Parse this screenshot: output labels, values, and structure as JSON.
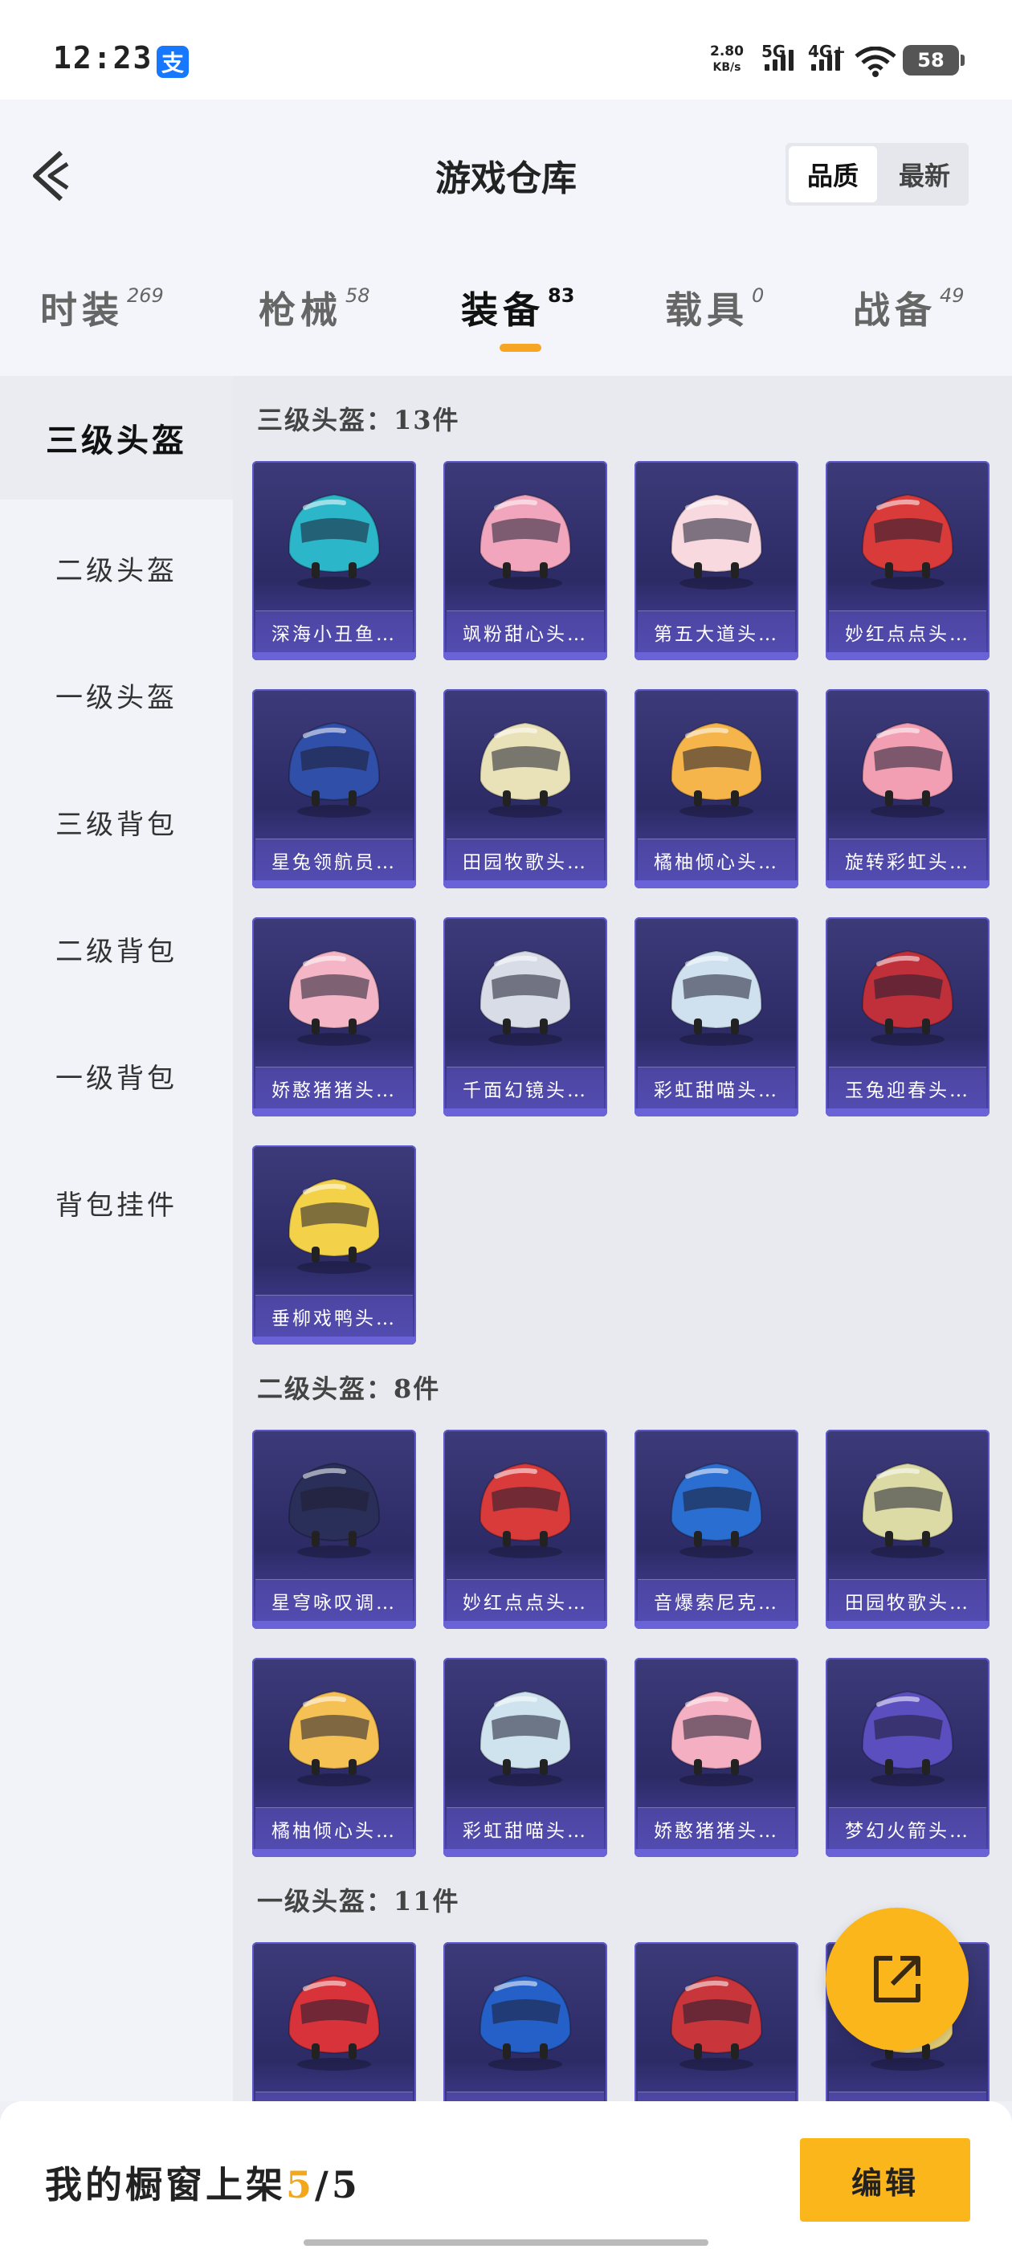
{
  "status_bar": {
    "time": "12:23",
    "alipay_glyph": "支",
    "speed_value": "2.80",
    "speed_unit": "KB/s",
    "net1": "5G",
    "net2": "4G+",
    "battery": "58"
  },
  "header": {
    "title": "游戏仓库",
    "sort_options": [
      "品质",
      "最新"
    ],
    "sort_active": "品质"
  },
  "tabs": [
    {
      "label": "时装",
      "count": "269"
    },
    {
      "label": "枪械",
      "count": "58"
    },
    {
      "label": "装备",
      "count": "83",
      "active": true
    },
    {
      "label": "载具",
      "count": "0"
    },
    {
      "label": "战备",
      "count": "49"
    }
  ],
  "sidebar": {
    "items": [
      "三级头盔",
      "二级头盔",
      "一级头盔",
      "三级背包",
      "二级背包",
      "一级背包",
      "背包挂件"
    ],
    "active": "三级头盔"
  },
  "sections": [
    {
      "title": "三级头盔：13件",
      "items": [
        {
          "name": "深海小丑鱼…",
          "icon": "helmet-icon",
          "color": "#2bb7c9"
        },
        {
          "name": "飒粉甜心头…",
          "icon": "helmet-icon",
          "color": "#f2a6bd"
        },
        {
          "name": "第五大道头…",
          "icon": "helmet-icon",
          "color": "#f7d9df"
        },
        {
          "name": "妙红点点头…",
          "icon": "helmet-icon",
          "color": "#d93a3a"
        },
        {
          "name": "星兔领航员…",
          "icon": "helmet-icon",
          "color": "#2f4fa8"
        },
        {
          "name": "田园牧歌头…",
          "icon": "helmet-icon",
          "color": "#e9e2b8"
        },
        {
          "name": "橘柚倾心头…",
          "icon": "helmet-icon",
          "color": "#f5b54a"
        },
        {
          "name": "旋转彩虹头…",
          "icon": "helmet-icon",
          "color": "#f29fb3"
        },
        {
          "name": "娇憨猪猪头…",
          "icon": "helmet-icon",
          "color": "#f4b6c6"
        },
        {
          "name": "千面幻镜头…",
          "icon": "helmet-icon",
          "color": "#d8dce6"
        },
        {
          "name": "彩虹甜喵头…",
          "icon": "helmet-icon",
          "color": "#cfe0ef"
        },
        {
          "name": "玉兔迎春头…",
          "icon": "helmet-icon",
          "color": "#c0303a"
        },
        {
          "name": "垂柳戏鸭头…",
          "icon": "helmet-icon",
          "color": "#f3d24a"
        }
      ]
    },
    {
      "title": "二级头盔：8件",
      "items": [
        {
          "name": "星穹咏叹调…",
          "icon": "helmet-icon",
          "color": "#2a2f5a"
        },
        {
          "name": "妙红点点头…",
          "icon": "helmet-icon",
          "color": "#d93a3a"
        },
        {
          "name": "音爆索尼克…",
          "icon": "helmet-icon",
          "color": "#2b6ed1"
        },
        {
          "name": "田园牧歌头…",
          "icon": "helmet-icon",
          "color": "#dcdba6"
        },
        {
          "name": "橘柚倾心头…",
          "icon": "helmet-icon",
          "color": "#f5c054"
        },
        {
          "name": "彩虹甜喵头…",
          "icon": "helmet-icon",
          "color": "#cfe3ee"
        },
        {
          "name": "娇憨猪猪头…",
          "icon": "helmet-icon",
          "color": "#f4b0c2"
        },
        {
          "name": "梦幻火箭头…",
          "icon": "helmet-icon",
          "color": "#5b4fc0"
        }
      ]
    },
    {
      "title": "一级头盔：11件",
      "items": [
        {
          "name": "",
          "icon": "helmet-icon",
          "color": "#d8333a"
        },
        {
          "name": "",
          "icon": "helmet-icon",
          "color": "#2460c8"
        },
        {
          "name": "",
          "icon": "helmet-icon",
          "color": "#c8363c"
        },
        {
          "name": "",
          "icon": "helmet-icon",
          "color": "#e8d27a"
        }
      ]
    }
  ],
  "bottom": {
    "label_prefix": "我的橱窗上架",
    "current": "5",
    "sep": "/",
    "total": "5",
    "edit_label": "编辑"
  }
}
